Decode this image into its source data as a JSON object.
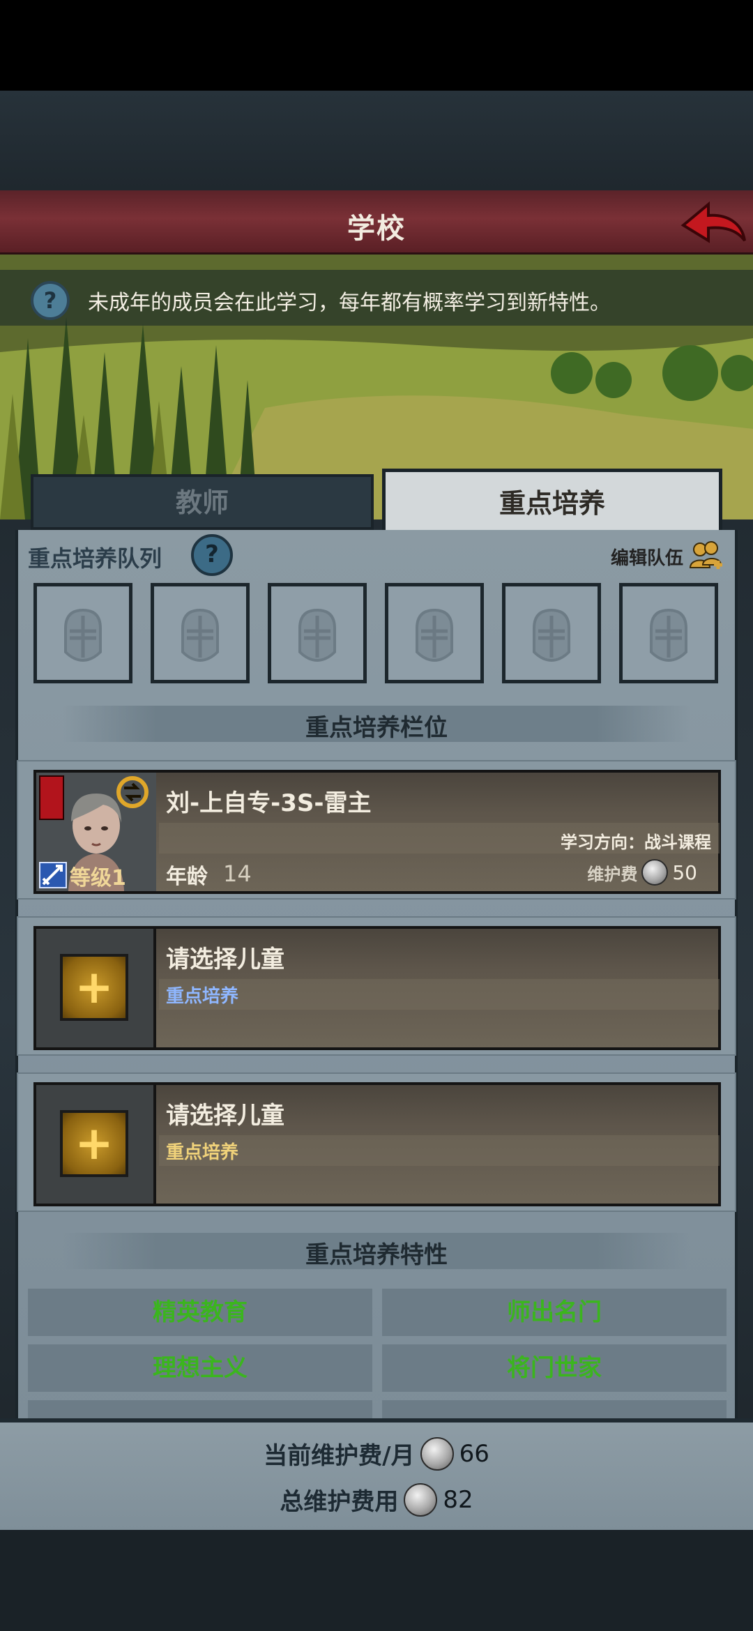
{
  "header": {
    "title": "学校"
  },
  "info": {
    "text": "未成年的成员会在此学习，每年都有概率学习到新特性。",
    "icon": "?"
  },
  "tabs": [
    {
      "label": "教师",
      "active": false
    },
    {
      "label": "重点培养",
      "active": true
    }
  ],
  "queue": {
    "title": "重点培养队列",
    "help": "?",
    "edit_label": "编辑队伍",
    "slot_count": 6
  },
  "slots_section": {
    "title": "重点培养栏位"
  },
  "student": {
    "name": "刘-上自专-3S-雷主",
    "level": "等级1",
    "age_label": "年龄",
    "age_value": "14",
    "study_direction": "学习方向：战斗课程",
    "fee_label": "维护费",
    "fee_value": "50"
  },
  "empty_slots": [
    {
      "title": "请选择儿童",
      "subtitle": "重点培养",
      "add": "+"
    },
    {
      "title": "请选择儿童",
      "subtitle": "重点培养",
      "add": "+"
    }
  ],
  "traits_section": {
    "title": "重点培养特性",
    "items": [
      "精英教育",
      "师出名门",
      "理想主义",
      "将门世家"
    ]
  },
  "footer": {
    "monthly_label": "当前维护费/月",
    "monthly_value": "66",
    "total_label": "总维护费用",
    "total_value": "82"
  },
  "colors": {
    "header": "#7a3036",
    "trait_text": "#3bb51e",
    "subtitle": "#8fb7ff"
  }
}
